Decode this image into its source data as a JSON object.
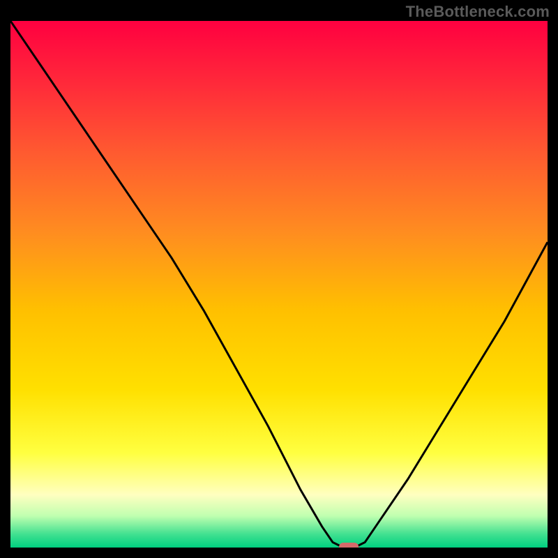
{
  "watermark": "TheBottleneck.com",
  "chart_data": {
    "type": "line",
    "title": "",
    "xlabel": "",
    "ylabel": "",
    "xlim": [
      0,
      100
    ],
    "ylim": [
      0,
      100
    ],
    "grid": false,
    "legend": false,
    "series": [
      {
        "name": "bottleneck-curve",
        "color": "#000000",
        "x": [
          0,
          6,
          12,
          18,
          24,
          30,
          36,
          42,
          48,
          54,
          58,
          60,
          62,
          64,
          66,
          68,
          74,
          80,
          86,
          92,
          100
        ],
        "y": [
          100,
          91,
          82,
          73,
          64,
          55,
          45,
          34,
          23,
          11,
          4,
          1,
          0,
          0,
          1,
          4,
          13,
          23,
          33,
          43,
          58
        ]
      }
    ],
    "marker": {
      "name": "optimal-point",
      "x": 63,
      "y": 0,
      "color": "#d46a6a",
      "shape": "rounded-rect"
    },
    "background_gradient": {
      "type": "vertical",
      "stops": [
        {
          "pos": 0.0,
          "color": "#ff0040"
        },
        {
          "pos": 0.12,
          "color": "#ff2a3a"
        },
        {
          "pos": 0.25,
          "color": "#ff5a30"
        },
        {
          "pos": 0.4,
          "color": "#ff8c20"
        },
        {
          "pos": 0.55,
          "color": "#ffc000"
        },
        {
          "pos": 0.7,
          "color": "#ffe000"
        },
        {
          "pos": 0.82,
          "color": "#ffff40"
        },
        {
          "pos": 0.9,
          "color": "#ffffc0"
        },
        {
          "pos": 0.94,
          "color": "#c0ffb0"
        },
        {
          "pos": 0.975,
          "color": "#40e090"
        },
        {
          "pos": 1.0,
          "color": "#00d080"
        }
      ]
    }
  }
}
